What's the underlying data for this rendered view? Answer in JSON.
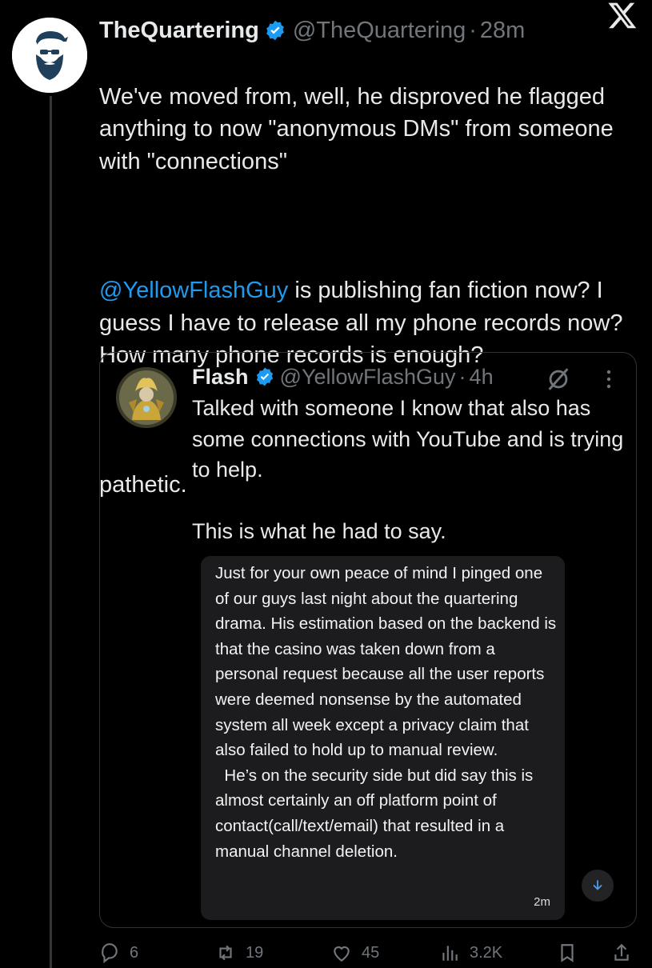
{
  "tweet": {
    "author_name": "TheQuartering",
    "author_handle": "@TheQuartering",
    "separator": "·",
    "time": "28m",
    "body_line1": "We've moved from, well, he disproved he flagged anything to now \"anonymous DMs\" from someone with \"connections\"",
    "mention": "@YellowFlashGuy",
    "body_line2": " is publishing fan fiction now? I guess I have to release all my phone records now?  How many phone records is enough?",
    "body_line3": "pathetic."
  },
  "quote": {
    "author_name": "Flash",
    "author_handle": "@YellowFlashGuy",
    "separator": "·",
    "time": "4h",
    "body_line1": "Talked with someone I know that also has some connections with YouTube and is trying to help.",
    "body_line2": "This is what he had to say.",
    "dm_text": "Just for your own peace of mind I pinged one of our guys last night about the quartering drama. His estimation based on the backend is that the casino was taken down from a personal request because all the user reports were deemed nonsense by the automated system all week except a privacy claim that also failed to hold up to manual review.\n  He’s on the security side but did say this is almost certainly an off platform point of contact(call/text/email) that resulted in a manual channel deletion.",
    "dm_time": "2m"
  },
  "actions": {
    "reply_count": "6",
    "retweet_count": "19",
    "like_count": "45",
    "view_count": "3.2K"
  },
  "icons": {
    "close": "x-logo-icon",
    "verified": "verified-badge-icon",
    "grok": "grok-icon",
    "more": "more-vertical-icon",
    "scroll": "arrow-down-icon",
    "reply": "reply-icon",
    "retweet": "retweet-icon",
    "like": "heart-icon",
    "views": "bar-chart-icon",
    "bookmark": "bookmark-icon",
    "share": "share-icon"
  },
  "colors": {
    "background": "#000000",
    "text": "#e7e9ea",
    "muted": "#71767b",
    "link": "#1d9bf0",
    "verified": "#1d9bf0",
    "dm_bubble": "#1c1c1e"
  }
}
